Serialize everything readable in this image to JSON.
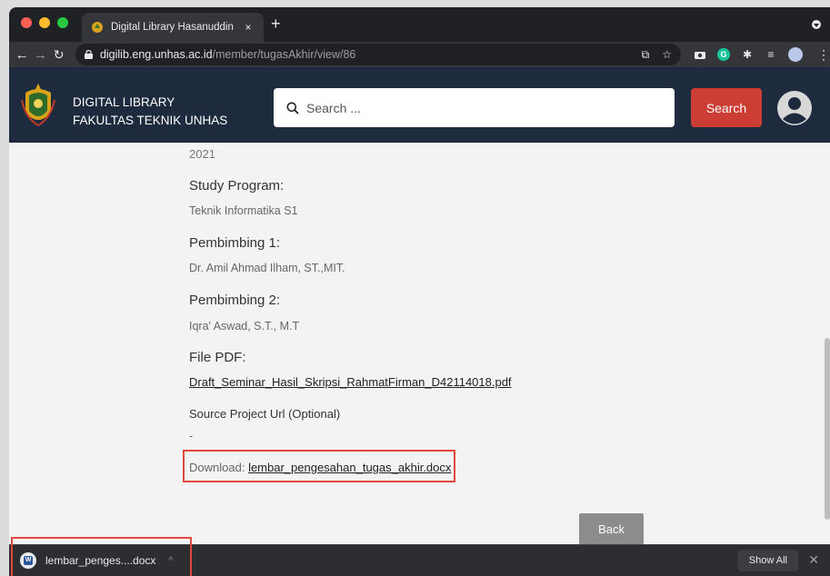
{
  "browser": {
    "tab_title": "Digital Library Hasanuddin Uni",
    "tab_close": "×",
    "new_tab": "+",
    "url_host": "digilib.eng.unhas.ac.id",
    "url_path": "/member/tugasAkhir/view/86"
  },
  "header": {
    "brand_line1": "DIGITAL LIBRARY",
    "brand_line2": "FAKULTAS TEKNIK UNHAS",
    "search_placeholder": "Search ...",
    "search_button": "Search"
  },
  "details": {
    "year": "2021",
    "study_program_label": "Study Program:",
    "study_program_value": "Teknik Informatika S1",
    "pembimbing1_label": "Pembimbing 1:",
    "pembimbing1_value": "Dr. Amil Ahmad Ilham, ST.,MIT.",
    "pembimbing2_label": "Pembimbing 2:",
    "pembimbing2_value": "Iqra' Aswad, S.T., M.T",
    "file_pdf_label": "File PDF:",
    "file_pdf_link": "Draft_Seminar_Hasil_Skripsi_RahmatFirman_D42114018.pdf",
    "source_label": "Source Project Url (Optional)",
    "source_value": "-",
    "download_label": "Download:",
    "download_link": "lembar_pengesahan_tugas_akhir.docx",
    "back_button": "Back"
  },
  "download_shelf": {
    "file_name": "lembar_penges....docx",
    "show_all": "Show All",
    "close": "✕"
  },
  "colors": {
    "header_bg": "#1e2a3e",
    "search_button": "#cc3d33",
    "highlight": "#e0483d"
  }
}
